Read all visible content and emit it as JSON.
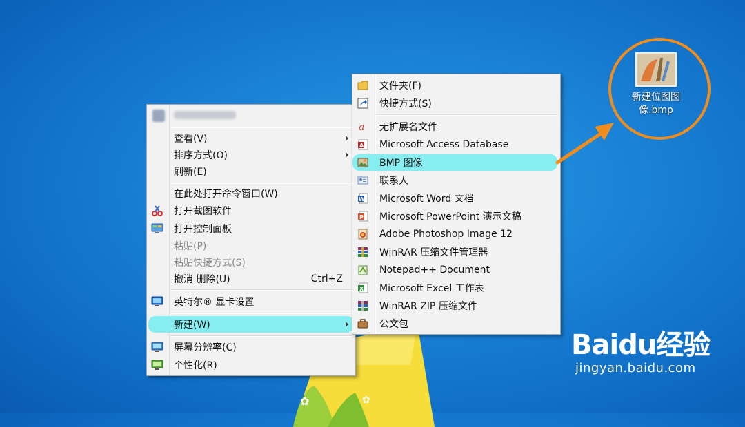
{
  "context_menu": {
    "header_text": "",
    "items": [
      {
        "label": "查看(V)",
        "arrow": true
      },
      {
        "label": "排序方式(O)",
        "arrow": true
      },
      {
        "label": "刷新(E)"
      },
      {
        "label": "在此处打开命令窗口(W)"
      },
      {
        "label": "打开截图软件",
        "icon": "scissors-icon"
      },
      {
        "label": "打开控制面板",
        "icon": "control-panel-icon"
      },
      {
        "label": "粘贴(P)",
        "disabled": true
      },
      {
        "label": "粘贴快捷方式(S)",
        "disabled": true
      },
      {
        "label": "撤消 删除(U)",
        "shortcut": "Ctrl+Z"
      },
      {
        "label": "英特尔® 显卡设置",
        "icon": "intel-graphics-icon"
      },
      {
        "label": "新建(W)",
        "arrow": true,
        "highlighted": true
      },
      {
        "label": "屏幕分辨率(C)",
        "icon": "display-icon"
      },
      {
        "label": "个性化(R)",
        "icon": "personalize-icon"
      }
    ]
  },
  "submenu": {
    "items": [
      {
        "label": "文件夹(F)",
        "icon": "folder-icon"
      },
      {
        "label": "快捷方式(S)",
        "icon": "shortcut-icon"
      },
      {
        "label": "无扩展名文件",
        "icon": "file-icon"
      },
      {
        "label": "Microsoft Access Database",
        "icon": "access-icon"
      },
      {
        "label": "BMP 图像",
        "icon": "bmp-icon",
        "highlighted": true
      },
      {
        "label": "联系人",
        "icon": "contact-icon"
      },
      {
        "label": "Microsoft Word 文档",
        "icon": "word-icon"
      },
      {
        "label": "Microsoft PowerPoint 演示文稿",
        "icon": "powerpoint-icon"
      },
      {
        "label": "Adobe Photoshop Image 12",
        "icon": "photoshop-icon"
      },
      {
        "label": "WinRAR 压缩文件管理器",
        "icon": "winrar-icon"
      },
      {
        "label": "Notepad++ Document",
        "icon": "notepadpp-icon"
      },
      {
        "label": "Microsoft Excel 工作表",
        "icon": "excel-icon"
      },
      {
        "label": "WinRAR ZIP 压缩文件",
        "icon": "winrar-zip-icon"
      },
      {
        "label": "公文包",
        "icon": "briefcase-icon"
      }
    ]
  },
  "desktop_icon": {
    "label_line1": "新建位图图",
    "label_line2": "像.bmp"
  },
  "watermark": {
    "logo": "Baidu经验",
    "url": "jingyan.baidu.com"
  },
  "colors": {
    "highlight": "#86eef0",
    "annotation": "#ef8d1e",
    "desktop": "#1a82d6"
  }
}
